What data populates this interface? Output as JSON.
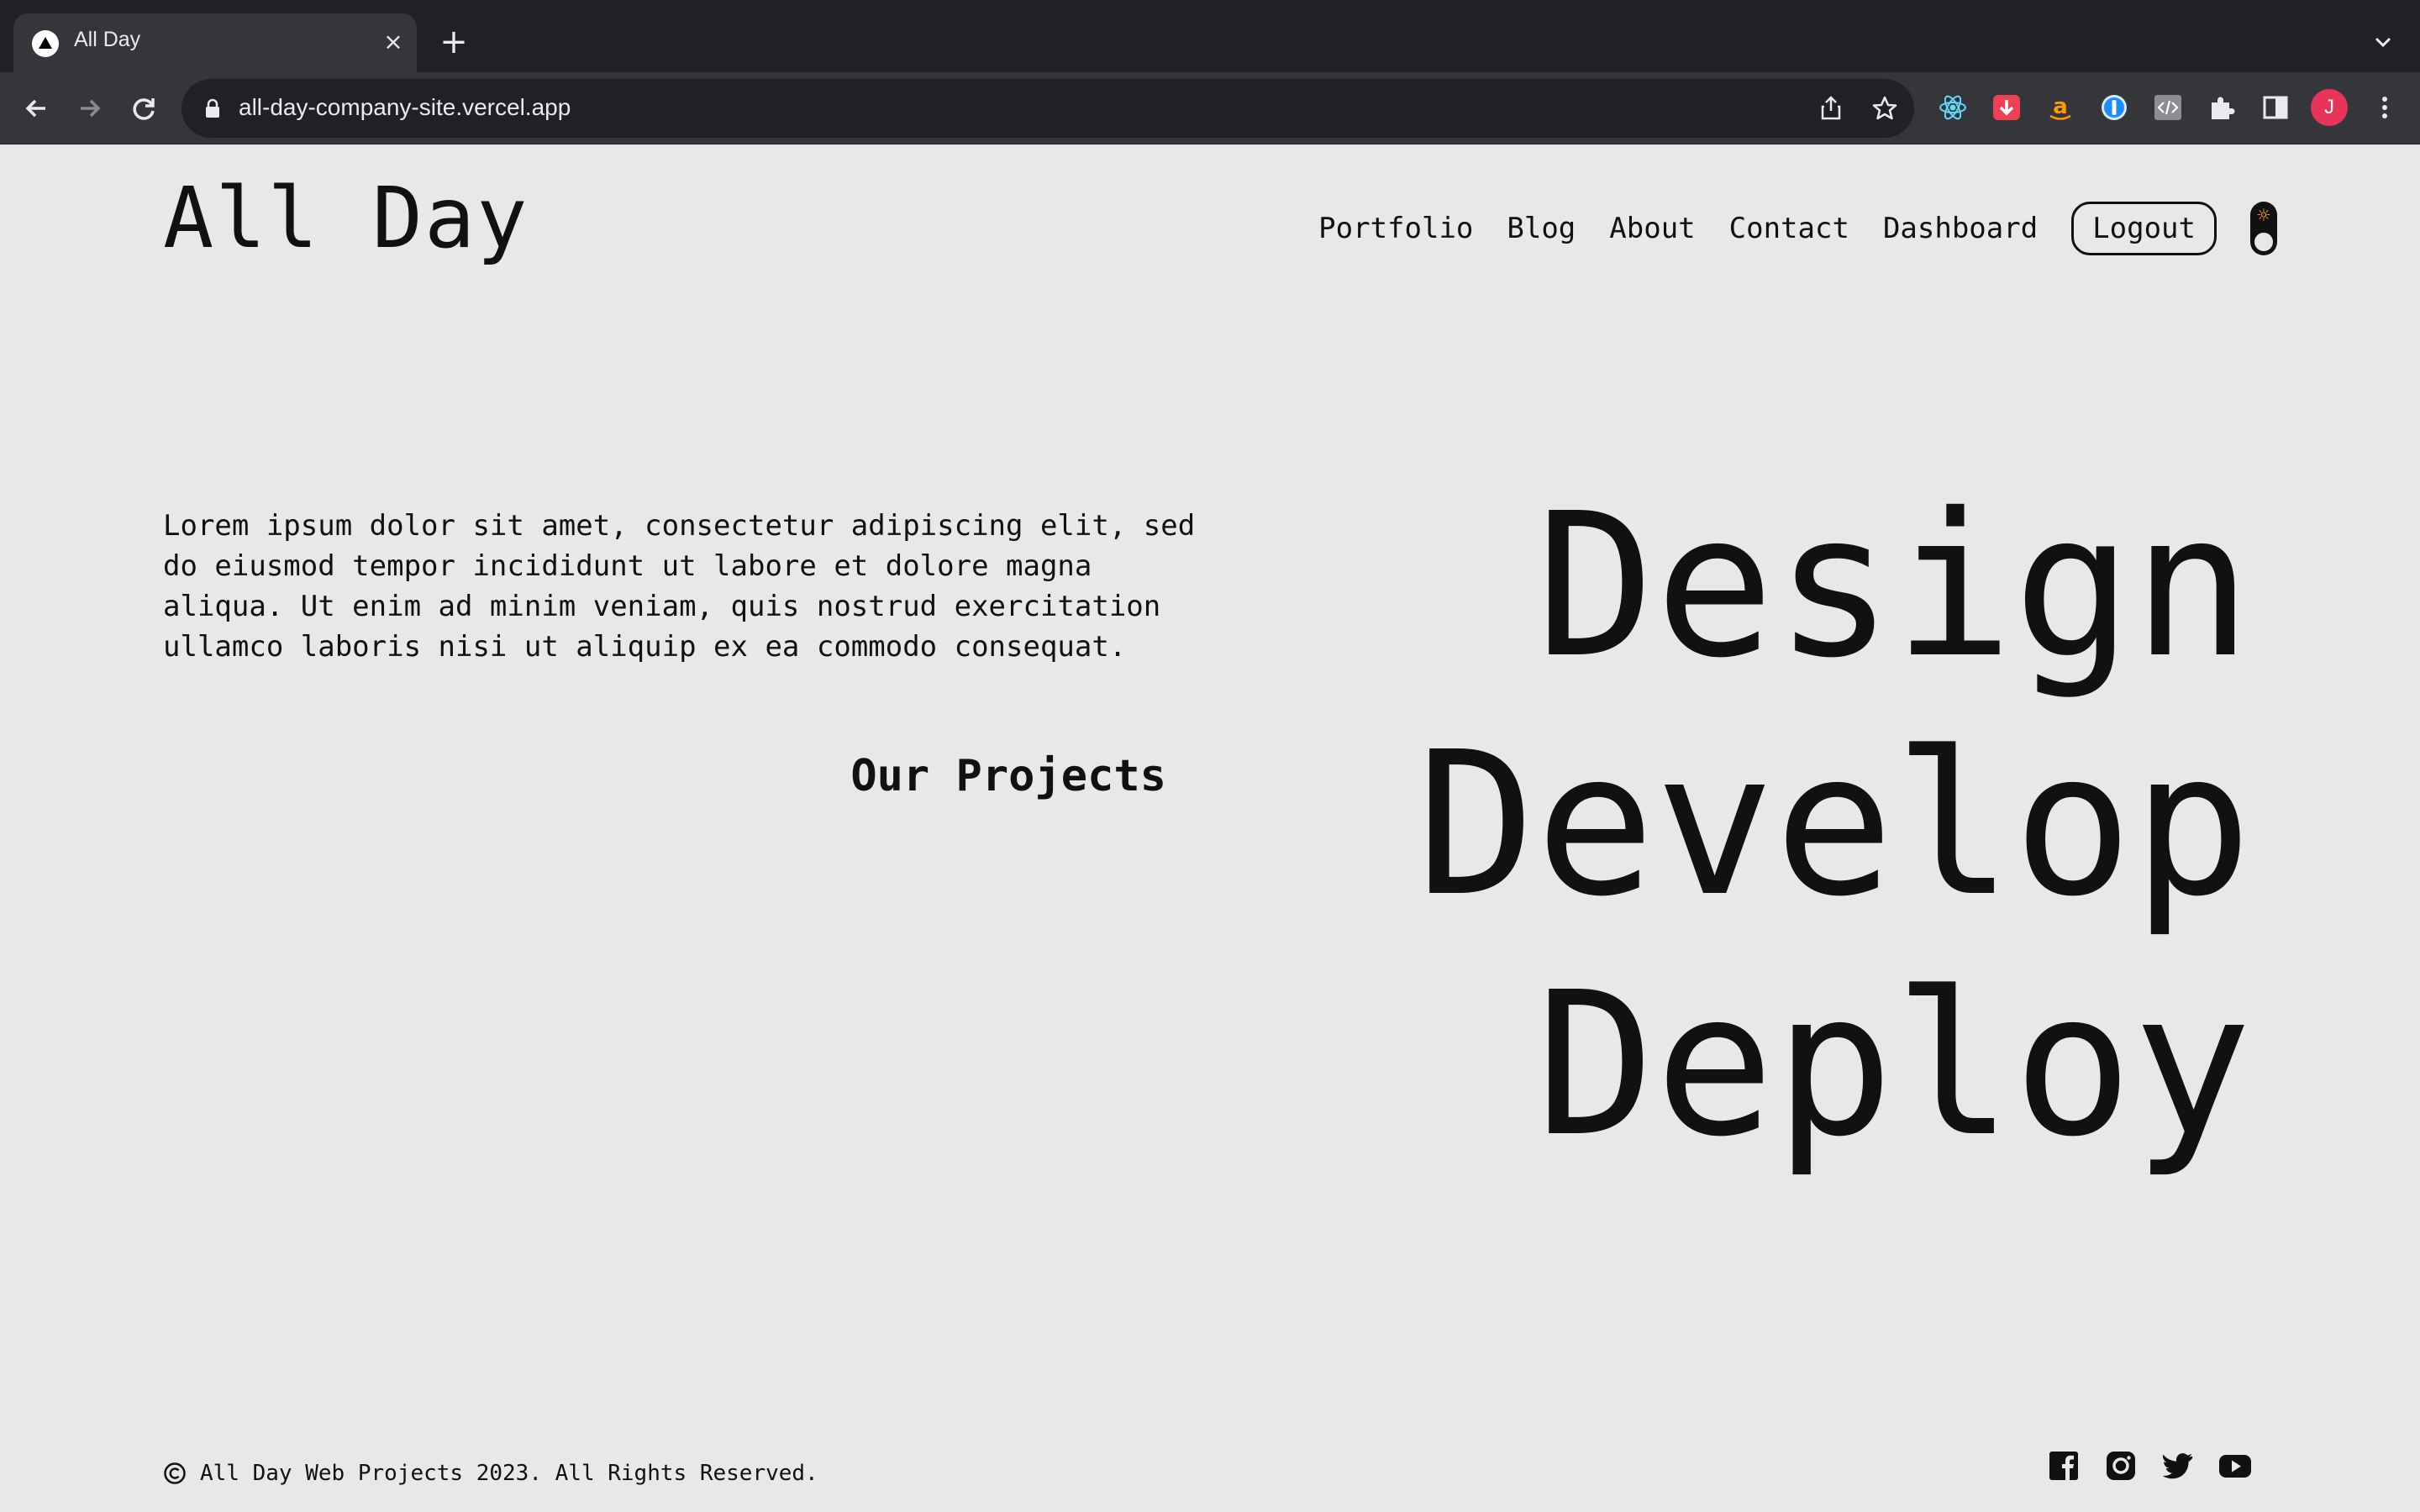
{
  "browser": {
    "tab_title": "All Day",
    "url": "all-day-company-site.vercel.app",
    "profile_initial": "J"
  },
  "site": {
    "logo": "All Day",
    "nav": [
      "Portfolio",
      "Blog",
      "About",
      "Contact",
      "Dashboard"
    ],
    "logout": "Logout",
    "intro": "Lorem ipsum dolor sit amet, consectetur adipiscing elit, sed do eiusmod tempor incididunt ut labore et dolore magna aliqua. Ut enim ad minim veniam, quis nostrud exercitation ullamco laboris nisi ut aliquip ex ea commodo consequat.",
    "projects_title": "Our Projects",
    "headlines": [
      "Design",
      "Develop",
      "Deploy"
    ],
    "footer": "All Day Web Projects 2023. All Rights Reserved."
  },
  "colors": {
    "page_bg": "#e8e8e8",
    "text": "#111111",
    "chrome_dark": "#202124",
    "chrome_toolbar": "#35363a",
    "toggle_sun": "#f5a623",
    "profile_bg": "#e8345a"
  },
  "icons": {
    "social": [
      "facebook-icon",
      "instagram-icon",
      "twitter-icon",
      "youtube-icon"
    ]
  }
}
